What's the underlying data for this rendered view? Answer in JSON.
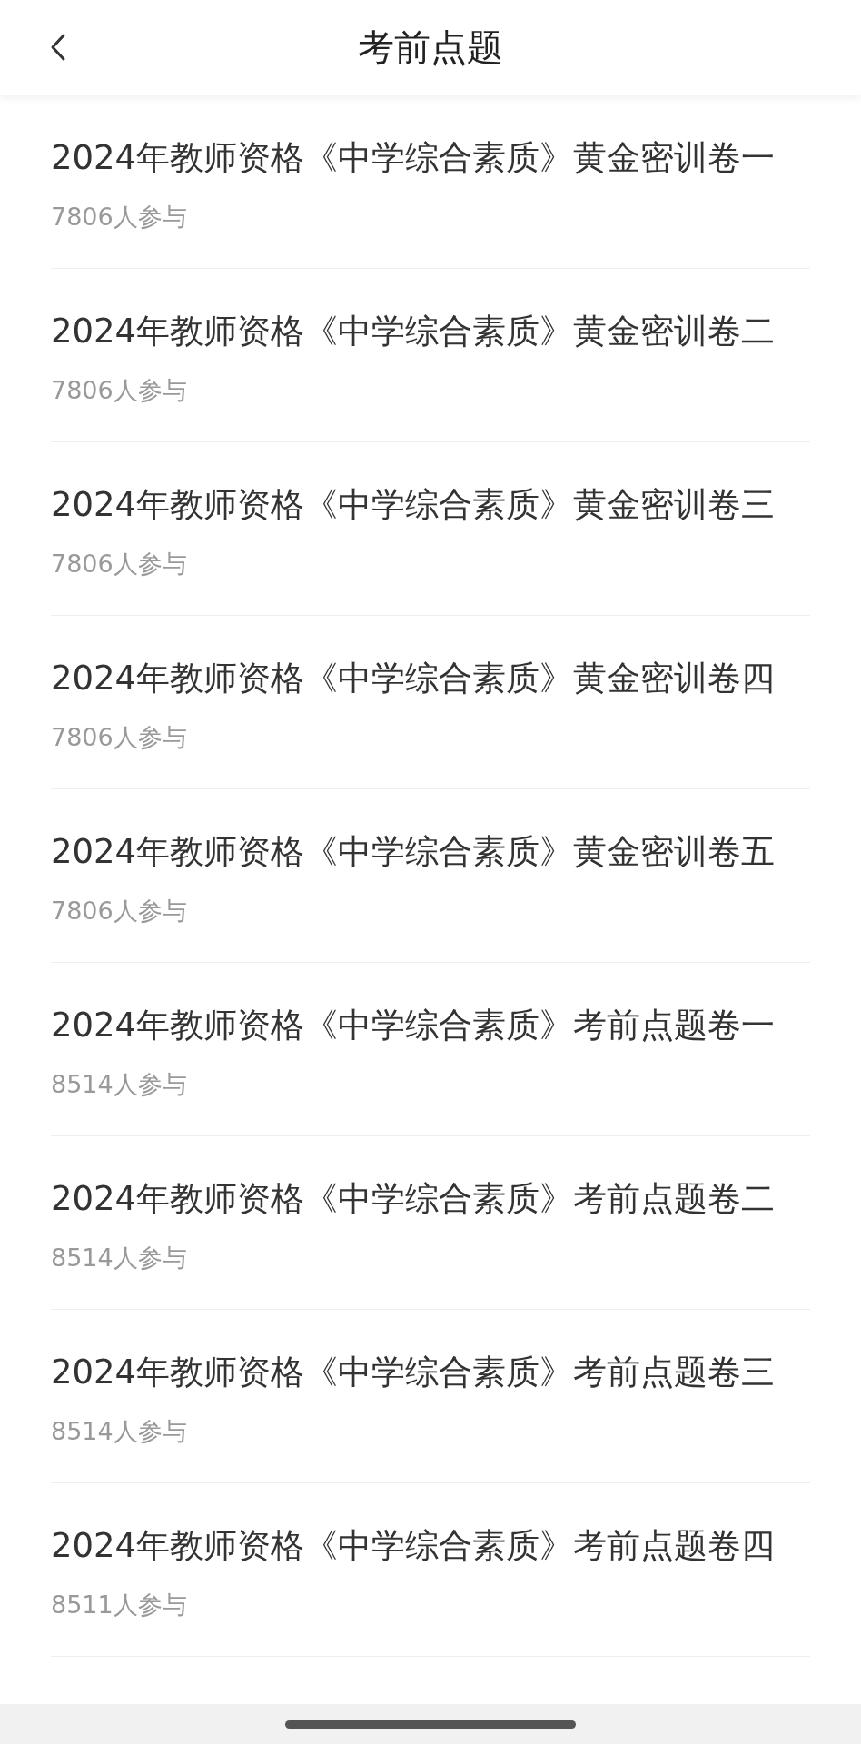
{
  "header": {
    "title": "考前点题"
  },
  "items": [
    {
      "title": "2024年教师资格《中学综合素质》黄金密训卷一",
      "participants": "7806人参与"
    },
    {
      "title": "2024年教师资格《中学综合素质》黄金密训卷二",
      "participants": "7806人参与"
    },
    {
      "title": "2024年教师资格《中学综合素质》黄金密训卷三",
      "participants": "7806人参与"
    },
    {
      "title": "2024年教师资格《中学综合素质》黄金密训卷四",
      "participants": "7806人参与"
    },
    {
      "title": "2024年教师资格《中学综合素质》黄金密训卷五",
      "participants": "7806人参与"
    },
    {
      "title": "2024年教师资格《中学综合素质》考前点题卷一",
      "participants": "8514人参与"
    },
    {
      "title": "2024年教师资格《中学综合素质》考前点题卷二",
      "participants": "8514人参与"
    },
    {
      "title": "2024年教师资格《中学综合素质》考前点题卷三",
      "participants": "8514人参与"
    },
    {
      "title": "2024年教师资格《中学综合素质》考前点题卷四",
      "participants": "8511人参与"
    }
  ]
}
